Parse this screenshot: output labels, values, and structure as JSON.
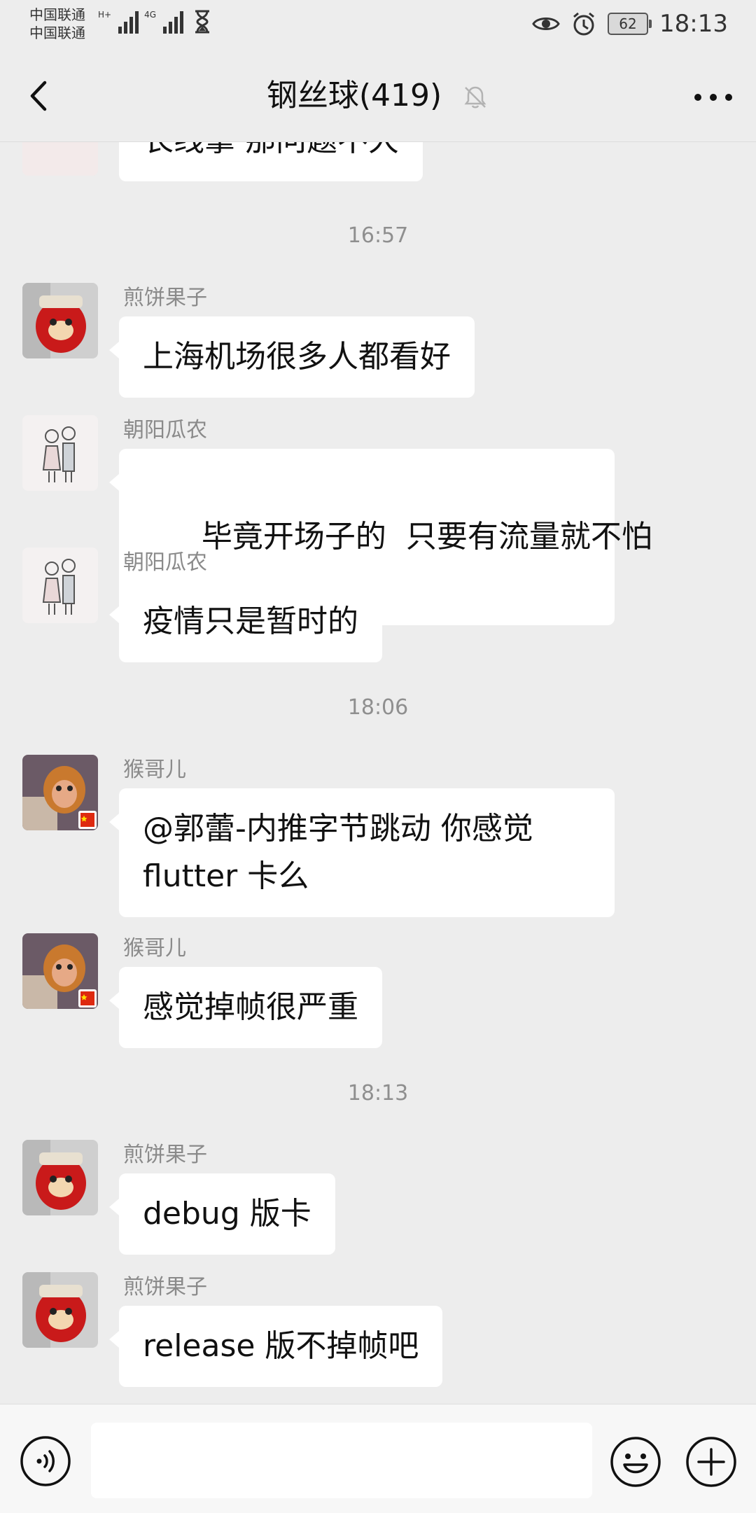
{
  "status_bar": {
    "carrier1": "中国联通",
    "carrier2": "中国联通",
    "net_tag1": "H+",
    "net_tag2": "4G",
    "battery": "62",
    "time": "18:13"
  },
  "header": {
    "title": "钢丝球(419)"
  },
  "chat": {
    "partial_message": "长线拿 那问题不大",
    "times": [
      "16:57",
      "18:06",
      "18:13"
    ],
    "messages": [
      {
        "sender": "煎饼果子",
        "text": "上海机场很多人都看好",
        "avatar": "red-dog-avatar"
      },
      {
        "sender": "朝阳瓜农",
        "text": "毕竟开场子的  只要有流量就不怕",
        "avatar": "couple-sketch-avatar"
      },
      {
        "sender": "朝阳瓜农",
        "text": "疫情只是暂时的",
        "avatar": "couple-sketch-avatar"
      },
      {
        "sender": "猴哥儿",
        "text": "@郭蕾-内推字节跳动 你感觉 flutter 卡么",
        "avatar": "monkey-king-avatar"
      },
      {
        "sender": "猴哥儿",
        "text": "感觉掉帧很严重",
        "avatar": "monkey-king-avatar"
      },
      {
        "sender": "煎饼果子",
        "text": "debug 版卡",
        "avatar": "red-dog-avatar"
      },
      {
        "sender": "煎饼果子",
        "text": "release 版不掉帧吧",
        "avatar": "red-dog-avatar"
      }
    ]
  },
  "input": {
    "value": ""
  },
  "colors": {
    "background": "#ededed",
    "bubble": "#ffffff",
    "sender": "#8a8a8a"
  }
}
